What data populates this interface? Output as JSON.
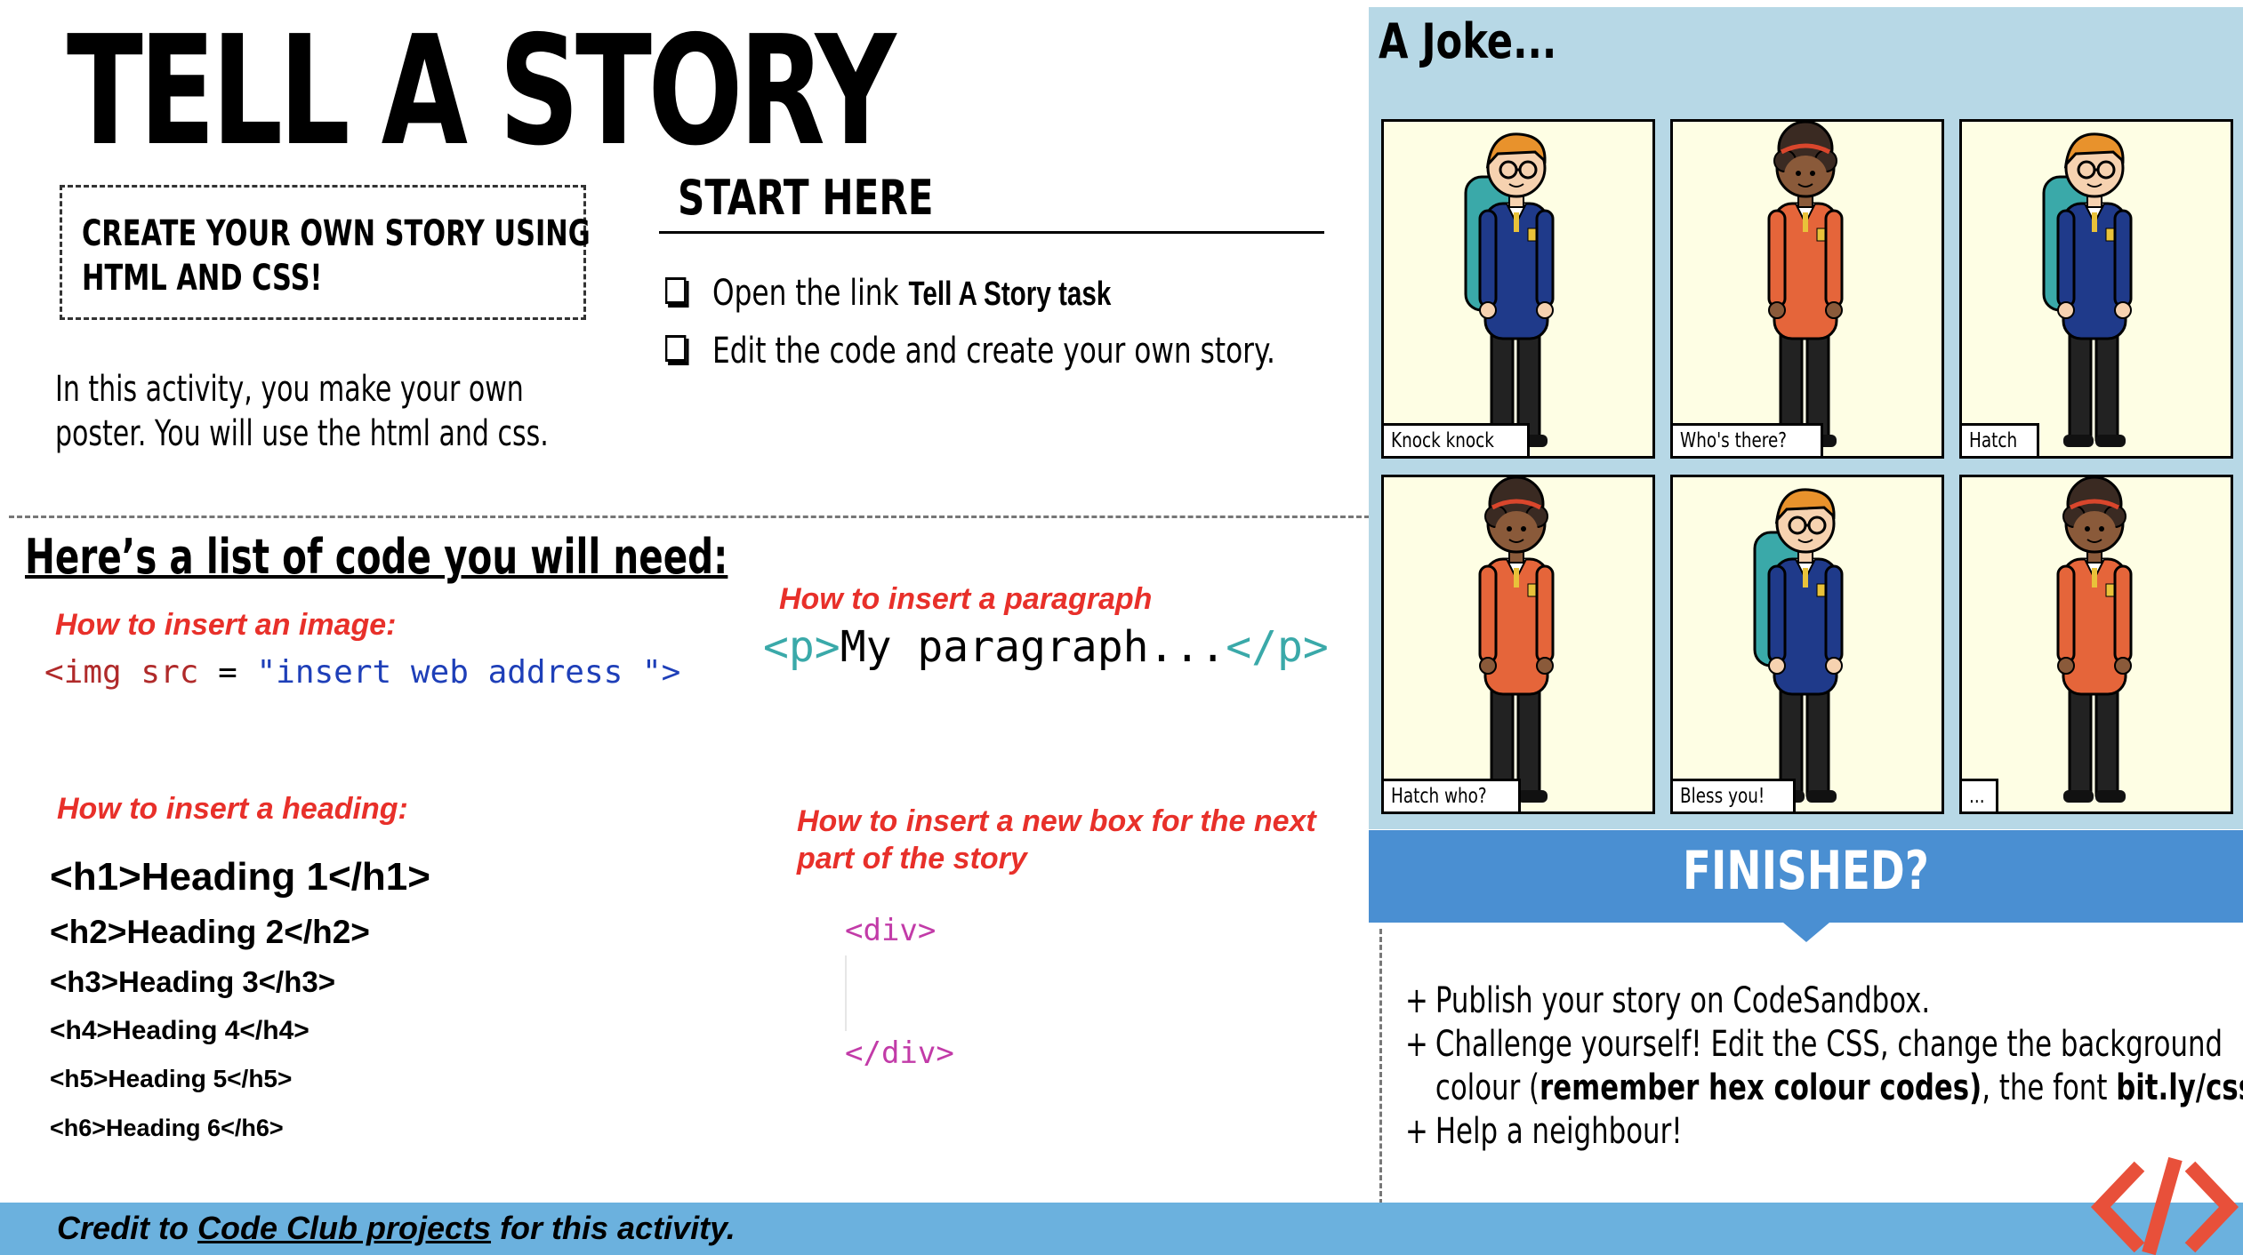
{
  "title": "TELL A STORY",
  "intro_box": {
    "line1": "CREATE YOUR OWN STORY USING",
    "line2": "HTML AND CSS!"
  },
  "intro_para": {
    "line1": "In this activity, you make your own",
    "line2": "poster.  You will use the html and css."
  },
  "start": {
    "title": "START HERE",
    "item1_text": "Open the link",
    "item1_link": "Tell A Story task",
    "item2_text": "Edit the code and create your own story."
  },
  "code": {
    "heading": "Here’s a list of code you will need:",
    "image_how": "How to insert an image:",
    "image_code": {
      "tag_open": "<img",
      "attr": "src",
      "eq": "=",
      "value": "\"insert web address \"",
      "tag_close": ">"
    },
    "para_how": "How to insert a paragraph",
    "para_code": {
      "open": "<p>",
      "text": "My paragraph...",
      "close": "</p>"
    },
    "heading_how": "How to insert a heading:",
    "headings": [
      "<h1>Heading 1</h1>",
      "<h2>Heading 2</h2>",
      "<h3>Heading 3</h3>",
      "<h4>Heading 4</h4>",
      "<h5>Heading 5</h5>",
      "<h6>Heading 6</h6>"
    ],
    "div_how_line1": "How to insert a new box for the next",
    "div_how_line2": "part of the story",
    "div_open": "<div>",
    "div_close": "</div>"
  },
  "comic": {
    "title": "A Joke...",
    "panels": [
      {
        "caption": "Knock knock",
        "character": "boy"
      },
      {
        "caption": "Who's there?",
        "character": "girl"
      },
      {
        "caption": "Hatch",
        "character": "boy"
      },
      {
        "caption": "Hatch who?",
        "character": "girl"
      },
      {
        "caption": "Bless you!",
        "character": "boy"
      },
      {
        "caption": "...",
        "character": "girl"
      }
    ]
  },
  "finished": {
    "title": "FINISHED?",
    "item1": "Publish your story on CodeSandbox.",
    "item2_line1": "Challenge yourself! Edit the CSS, change the background",
    "item2_line2_a": "colour (",
    "item2_line2_b": "remember hex colour codes)",
    "item2_line2_c": ", the font ",
    "item2_line2_d": "bit.ly/cssfonts",
    "item3": "Help a neighbour!",
    "bullet": "+"
  },
  "footer": {
    "pre": "Credit to ",
    "link": "Code Club projects",
    "post": " for this activity."
  },
  "colors": {
    "accent_red": "#e8302a",
    "comic_bg": "#b7d8e6",
    "finished_blue": "#4a8fd2",
    "footer_blue": "#6bb1de",
    "logo_red": "#e8503a"
  },
  "icons": {
    "logo": "code-brackets-icon",
    "checkbox": "checkbox-icon"
  }
}
